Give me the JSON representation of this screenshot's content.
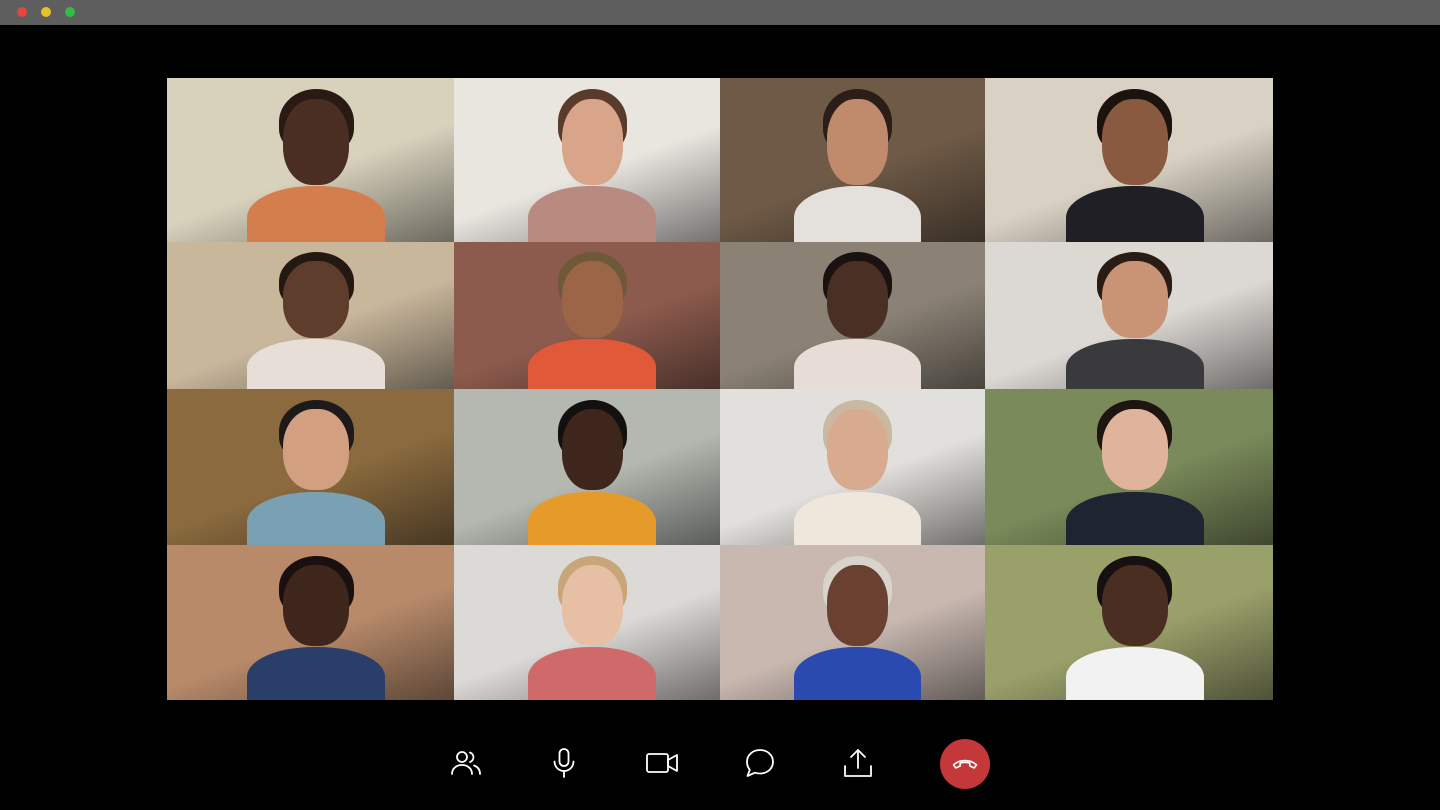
{
  "window": {
    "traffic_lights": [
      "#e2463f",
      "#e6c229",
      "#2fbf47"
    ],
    "titlebar_color": "#5e5e5e"
  },
  "participants": [
    {
      "id": 1,
      "bg": "#d8d2bd",
      "skin": "#4a2e22",
      "shirt": "#d47e4d",
      "hair": "#2a1a14"
    },
    {
      "id": 2,
      "bg": "#e9e6e0",
      "skin": "#d9a58a",
      "shirt": "#b98b80",
      "hair": "#5a3a2a"
    },
    {
      "id": 3,
      "bg": "#6e5a46",
      "skin": "#c08a6c",
      "shirt": "#e4e0dc",
      "hair": "#2b1d17"
    },
    {
      "id": 4,
      "bg": "#d9d2c4",
      "skin": "#8a5a40",
      "shirt": "#1f1f25",
      "hair": "#1c120e"
    },
    {
      "id": 5,
      "bg": "#c9b79c",
      "skin": "#5e3d2c",
      "shirt": "#e8ded8",
      "hair": "#241812"
    },
    {
      "id": 6,
      "bg": "#8d5b4d",
      "skin": "#9c6548",
      "shirt": "#e05a3a",
      "hair": "#6e5a3a"
    },
    {
      "id": 7,
      "bg": "#8b8275",
      "skin": "#4a3024",
      "shirt": "#e8ddd6",
      "hair": "#1a1210"
    },
    {
      "id": 8,
      "bg": "#dcd8d4",
      "skin": "#c99476",
      "shirt": "#3a3a3c",
      "hair": "#2a1c14"
    },
    {
      "id": 9,
      "bg": "#8a6a3e",
      "skin": "#d2a080",
      "shirt": "#7aa0b4",
      "hair": "#1e1a1a"
    },
    {
      "id": 10,
      "bg": "#b4b8b0",
      "skin": "#3e261c",
      "shirt": "#e59a2a",
      "hair": "#141010"
    },
    {
      "id": 11,
      "bg": "#e2e0dc",
      "skin": "#d8aa90",
      "shirt": "#efe6dc",
      "hair": "#c9b9a0"
    },
    {
      "id": 12,
      "bg": "#7a8a5a",
      "skin": "#e0b49a",
      "shirt": "#1e2430",
      "hair": "#1e1410"
    },
    {
      "id": 13,
      "bg": "#b88a6a",
      "skin": "#3e261c",
      "shirt": "#2a3e6a",
      "hair": "#1a1010"
    },
    {
      "id": 14,
      "bg": "#dcdad6",
      "skin": "#e6bfa4",
      "shirt": "#d06a6a",
      "hair": "#c8a67a"
    },
    {
      "id": 15,
      "bg": "#c8b8b0",
      "skin": "#6a4030",
      "shirt": "#2a4ab0",
      "hair": "#d8d4cc"
    },
    {
      "id": 16,
      "bg": "#9aa06a",
      "skin": "#4a2e22",
      "shirt": "#f2f2f2",
      "hair": "#161010"
    }
  ],
  "controls": [
    {
      "name": "participants-button",
      "icon": "people-icon"
    },
    {
      "name": "microphone-button",
      "icon": "microphone-icon"
    },
    {
      "name": "camera-button",
      "icon": "video-camera-icon"
    },
    {
      "name": "chat-button",
      "icon": "chat-bubble-icon"
    },
    {
      "name": "share-button",
      "icon": "share-upload-icon"
    },
    {
      "name": "end-call-button",
      "icon": "phone-hangup-icon",
      "color": "#c4383a"
    }
  ]
}
